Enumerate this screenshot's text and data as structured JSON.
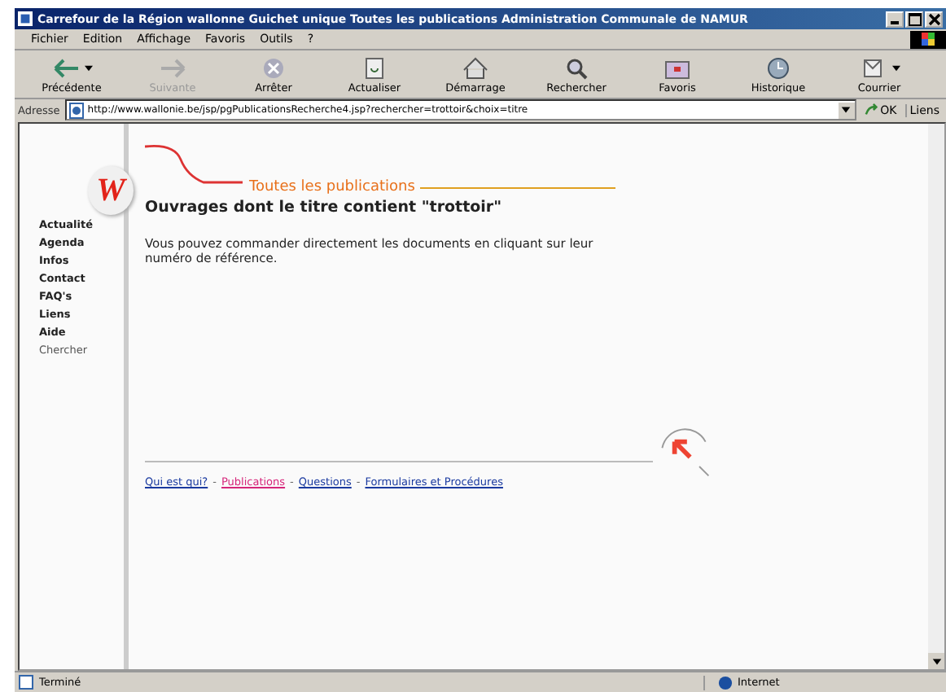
{
  "window": {
    "title": "Carrefour de la Région wallonne   Guichet unique   Toutes les publications   Administration Communale de NAMUR"
  },
  "menu": [
    "Fichier",
    "Edition",
    "Affichage",
    "Favoris",
    "Outils",
    "?"
  ],
  "toolbar": [
    {
      "label": "Précédente",
      "kind": "back",
      "disabled": false,
      "dropdown": true
    },
    {
      "label": "Suivante",
      "kind": "forward",
      "disabled": true,
      "dropdown": false
    },
    {
      "label": "Arrêter",
      "kind": "stop",
      "disabled": false,
      "dropdown": false
    },
    {
      "label": "Actualiser",
      "kind": "refresh",
      "disabled": false,
      "dropdown": false
    },
    {
      "label": "Démarrage",
      "kind": "home",
      "disabled": false,
      "dropdown": false
    },
    {
      "label": "Rechercher",
      "kind": "search",
      "disabled": false,
      "dropdown": false
    },
    {
      "label": "Favoris",
      "kind": "favorites",
      "disabled": false,
      "dropdown": false
    },
    {
      "label": "Historique",
      "kind": "history",
      "disabled": false,
      "dropdown": false
    },
    {
      "label": "Courrier",
      "kind": "mail",
      "disabled": false,
      "dropdown": true
    }
  ],
  "address": {
    "label": "Adresse",
    "value": "http://www.wallonie.be/jsp/pgPublicationsRecherche4.jsp?rechercher=trottoir&choix=titre",
    "go": "OK",
    "links": "Liens"
  },
  "page": {
    "logo": "W",
    "banner": "Toutes les publications",
    "sidebar": [
      {
        "label": "Actualité",
        "selected": false
      },
      {
        "label": "Agenda",
        "selected": false
      },
      {
        "label": "Infos",
        "selected": false
      },
      {
        "label": "Contact",
        "selected": false
      },
      {
        "label": "FAQ's",
        "selected": false
      },
      {
        "label": "Liens",
        "selected": false
      },
      {
        "label": "Aide",
        "selected": false
      },
      {
        "label": "Chercher",
        "selected": true
      }
    ],
    "heading": "Ouvrages dont le titre contient \"trottoir\"",
    "text": "Vous pouvez commander directement les documents en cliquant sur leur numéro de référence.",
    "footer_links": [
      {
        "label": "Qui est qui?",
        "selected": false
      },
      {
        "label": "Publications",
        "selected": true
      },
      {
        "label": "Questions",
        "selected": false
      },
      {
        "label": "Formulaires et Procédures",
        "selected": false
      }
    ],
    "separator": "-"
  },
  "status_bar": {
    "text": "Terminé",
    "zone": "Internet"
  }
}
